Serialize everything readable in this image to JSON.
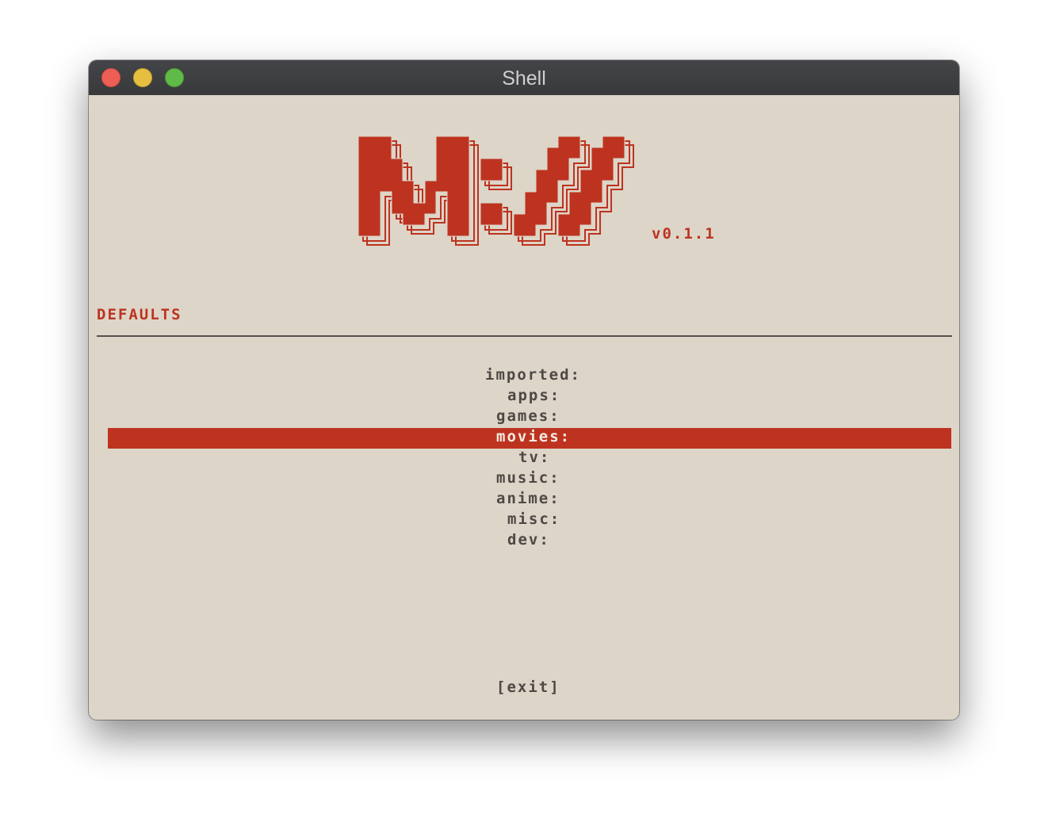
{
  "window": {
    "title": "Shell"
  },
  "app": {
    "logo_text": "M:V",
    "version": "v0.1.1"
  },
  "section": {
    "title": "DEFAULTS"
  },
  "menu": {
    "items": [
      {
        "label": "imported:"
      },
      {
        "label": "apps:"
      },
      {
        "label": "games:"
      },
      {
        "label": "movies:",
        "selected": true
      },
      {
        "label": "tv:"
      },
      {
        "label": "music:"
      },
      {
        "label": "anime:"
      },
      {
        "label": "misc:"
      },
      {
        "label": "dev:"
      }
    ]
  },
  "footer": {
    "exit_label": "[exit]"
  },
  "colors": {
    "accent": "#bd3320",
    "background": "#ddd5c8",
    "text": "#4d4845",
    "titlebar": "#3c3d3f"
  }
}
